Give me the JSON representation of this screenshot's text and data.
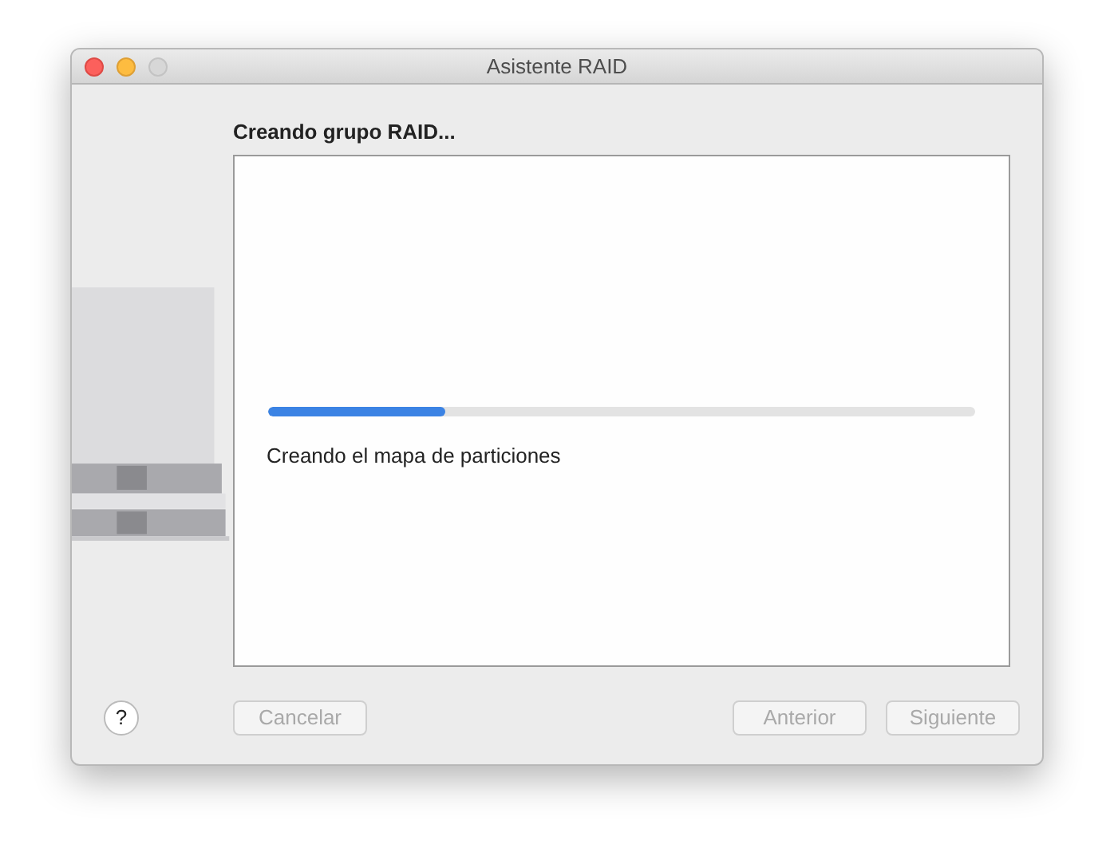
{
  "window": {
    "title": "Asistente RAID"
  },
  "heading": "Creando grupo RAID...",
  "progress": {
    "level": 0.25
  },
  "status": "Creando el mapa de particiones",
  "help": {
    "label": "?"
  },
  "buttons": [
    {
      "label": "Cancelar",
      "disabled": true,
      "kind": "left"
    },
    {
      "label": "Anterior",
      "disabled": true,
      "kind": "right"
    },
    {
      "label": "Siguiente",
      "disabled": true,
      "kind": "right"
    }
  ]
}
